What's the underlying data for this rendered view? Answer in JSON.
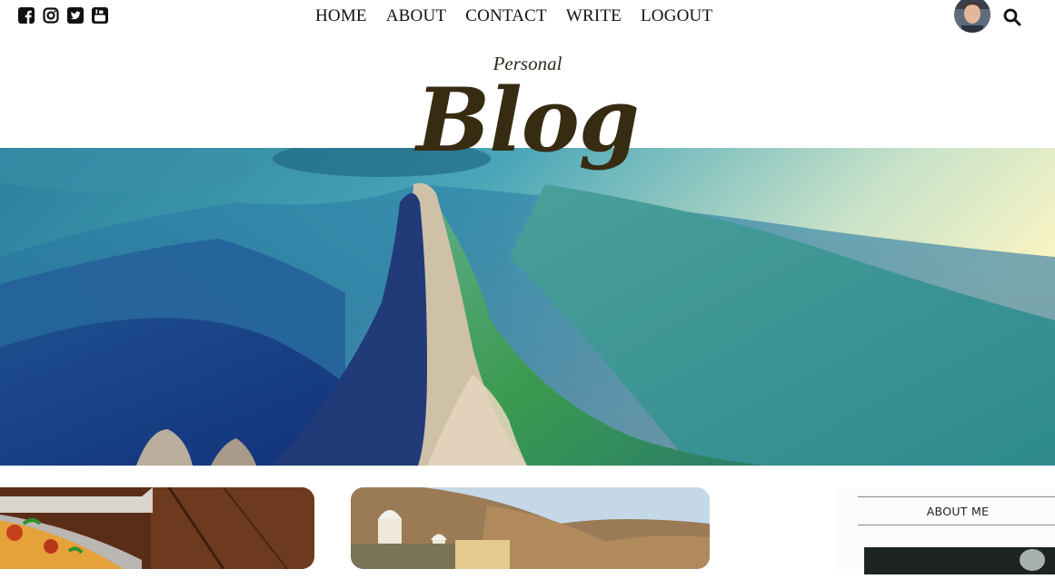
{
  "social": {
    "icons": [
      "facebook-square-icon",
      "instagram-icon",
      "twitter-square-icon",
      "youtube-square-icon"
    ]
  },
  "nav": {
    "items": [
      "HOME",
      "ABOUT",
      "CONTACT",
      "WRITE",
      "LOGOUT"
    ]
  },
  "header": {
    "subtitle": "Personal",
    "title": "Blog"
  },
  "sidebar": {
    "about_title": "ABOUT ME"
  },
  "colors": {
    "title": "#372c12",
    "text": "#111111",
    "sidebar_bg": "#fdfbfb"
  }
}
